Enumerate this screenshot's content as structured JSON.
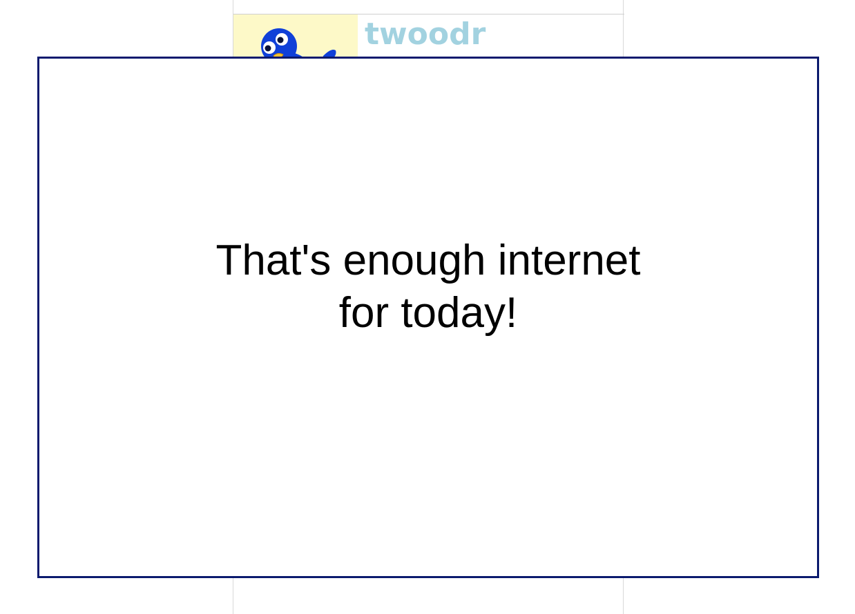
{
  "site": {
    "brand_name": "twoodr",
    "logo_icon": "blue-bird-mascot-icon"
  },
  "modal": {
    "message": "That's enough internet for today!"
  },
  "colors": {
    "brand_text": "#a2d2e0",
    "logo_background": "#fdf9c8",
    "modal_border": "#0b1a6e",
    "bird_blue": "#1040d8"
  }
}
